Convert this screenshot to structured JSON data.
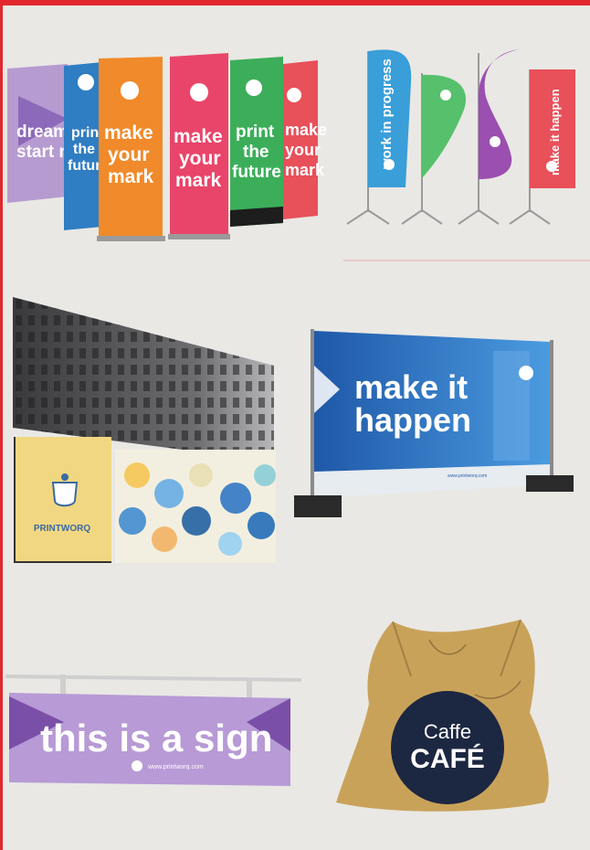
{
  "colors": {
    "page_bg": "#e9e8e4",
    "accent_red": "#e3262c",
    "purple": "#7b4fa3",
    "blue": "#2f6fb8",
    "orange": "#f08a2a",
    "pink": "#e9456a",
    "green": "#3cae5a",
    "red": "#e8505a",
    "banner_blue": "#2a62b0",
    "sign_purple": "#8b5fb5",
    "cafe_navy": "#1c2741",
    "beanbag_tan": "#c9a25a"
  },
  "rollup_banners": [
    {
      "lines": [
        "dream",
        "start n"
      ],
      "color": "#b69bd0"
    },
    {
      "lines": [
        "prin",
        "the",
        "future"
      ],
      "color": "#2f7dc2"
    },
    {
      "lines": [
        "make",
        "your",
        "mark"
      ],
      "color": "#f08a2a"
    },
    {
      "lines": [
        "make",
        "your",
        "mark"
      ],
      "color": "#e9456a"
    },
    {
      "lines": [
        "print",
        "the",
        "future"
      ],
      "color": "#3cae5a"
    },
    {
      "lines": [
        "make",
        "your",
        "mark"
      ],
      "color": "#e8505a"
    }
  ],
  "flags": [
    {
      "text": "work in progress",
      "color": "#3a9ed8"
    },
    {
      "text": "",
      "color": "#56c06c"
    },
    {
      "text": "",
      "color": "#9b4fb0"
    },
    {
      "text": "make it happen",
      "color": "#e8505a"
    }
  ],
  "fence_banner": {
    "line1": "make it",
    "line2": "happen",
    "footer": "www.printworq.com"
  },
  "wall_logo": "PRINTWORQ",
  "hanging_sign": {
    "text": "this is a sign",
    "footer": "www.printworq.com"
  },
  "beanbag": {
    "line1": "Caffe",
    "line2": "CAFÉ"
  }
}
